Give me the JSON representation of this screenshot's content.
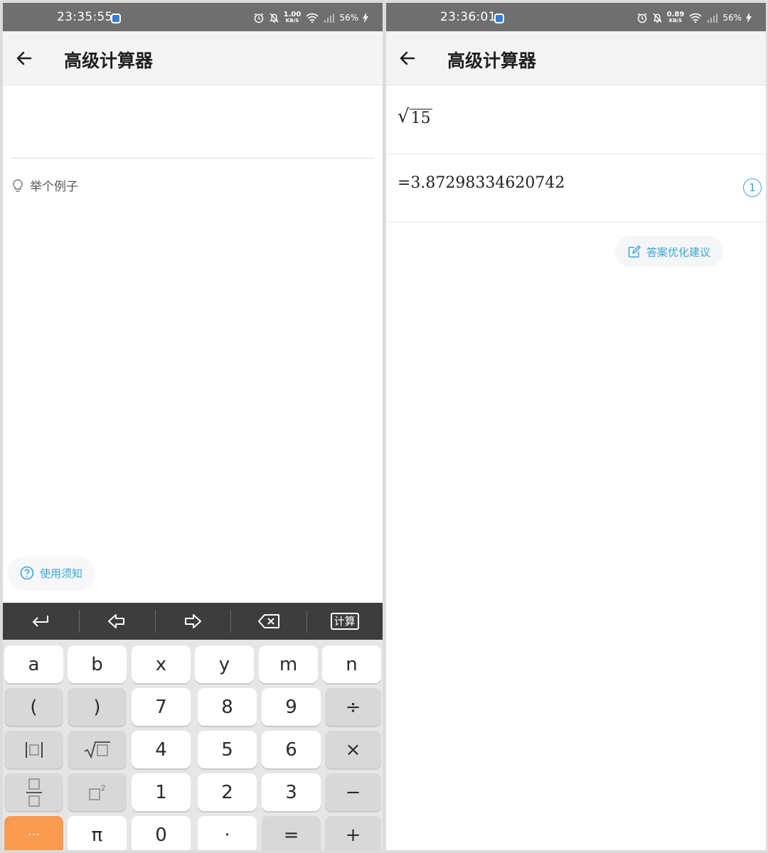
{
  "left": {
    "status": {
      "time": "23:35:55",
      "net_speed": "1.00",
      "net_unit": "KB/S",
      "battery": "56%"
    },
    "app_title": "高级计算器",
    "example_label": "举个例子",
    "help_label": "使用须知",
    "toolbar": {
      "calc_label": "计算"
    },
    "keys": {
      "row1": [
        "a",
        "b",
        "x",
        "y",
        "m",
        "n"
      ],
      "row2": [
        "(",
        ")",
        "7",
        "8",
        "9",
        "÷"
      ],
      "row3": [
        "4",
        "5",
        "6",
        "×"
      ],
      "row4": [
        "1",
        "2",
        "3",
        "−"
      ],
      "row5": [
        "···",
        "π",
        "0",
        "·",
        "=",
        "+"
      ]
    }
  },
  "right": {
    "status": {
      "time": "23:36:01",
      "net_speed": "0.89",
      "net_unit": "KB/S",
      "battery": "56%"
    },
    "app_title": "高级计算器",
    "expression_radicand": "15",
    "result": "=3.87298334620742",
    "badge": "1",
    "suggest_label": "答案优化建议"
  },
  "colors": {
    "accent": "#3aa6d3",
    "orange_key": "#f89a50",
    "toolbar": "#3d3d3d",
    "statusbar": "#6f6f6f"
  },
  "icons": [
    "back-arrow-icon",
    "lightbulb-icon",
    "help-icon",
    "enter-icon",
    "cursor-left-icon",
    "cursor-right-icon",
    "backspace-icon",
    "abs-icon",
    "sqrt-icon",
    "fraction-icon",
    "square-icon",
    "edit-icon",
    "alarm-icon",
    "bell-off-icon",
    "wifi-icon",
    "signal-icon",
    "charging-icon"
  ]
}
